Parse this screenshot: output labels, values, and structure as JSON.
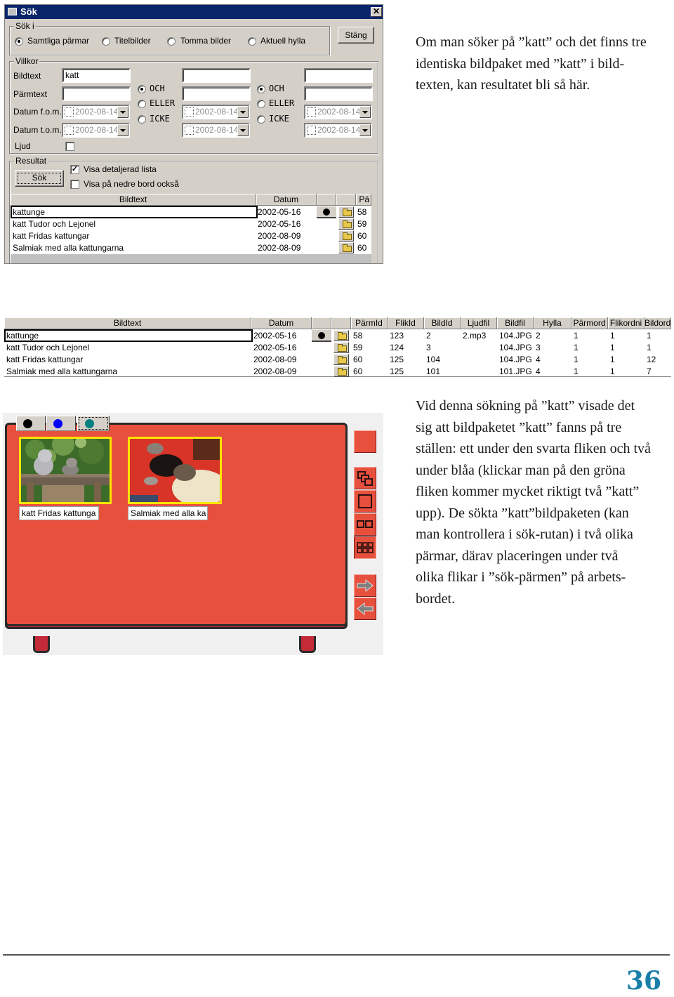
{
  "dialog": {
    "title": "Sök",
    "close_label": "✕",
    "sok_i": {
      "label": "Sök i",
      "options": [
        {
          "label": "Samtliga pärmar",
          "selected": true
        },
        {
          "label": "Titelbilder",
          "selected": false
        },
        {
          "label": "Tomma bilder",
          "selected": false
        },
        {
          "label": "Aktuell hylla",
          "selected": false
        }
      ]
    },
    "close_button": "Stäng",
    "villkor": {
      "label": "Villkor",
      "row_labels": [
        "Bildtext",
        "Pärmtext",
        "Datum f.o.m.",
        "Datum t.o.m.",
        "Ljud"
      ],
      "col1": {
        "bildtext": "katt",
        "parmtext": "",
        "date_from": "2002-08-14",
        "date_to": "2002-08-14"
      },
      "col2": {
        "bildtext": "",
        "parmtext": "",
        "date_from": "2002-08-14",
        "date_to": "2002-08-14"
      },
      "col3": {
        "bildtext": "",
        "parmtext": "",
        "date_from": "2002-08-14",
        "date_to": "2002-08-14"
      },
      "logic1": [
        {
          "label": "OCH",
          "selected": true
        },
        {
          "label": "ELLER",
          "selected": false
        },
        {
          "label": "ICKE",
          "selected": false
        }
      ],
      "logic2": [
        {
          "label": "OCH",
          "selected": true
        },
        {
          "label": "ELLER",
          "selected": false
        },
        {
          "label": "ICKE",
          "selected": false
        }
      ],
      "ljud_checked": false
    },
    "resultat": {
      "label": "Resultat",
      "search_button": "Sök",
      "show_detailed": {
        "label": "Visa detaljerad lista",
        "checked": true
      },
      "show_lower": {
        "label": "Visa på nedre bord också",
        "checked": false
      }
    },
    "grid": {
      "headers": [
        "Bildtext",
        "Datum",
        "",
        "",
        "Pä"
      ],
      "rows": [
        {
          "bildtext": "kattunge",
          "datum": "2002-05-16",
          "dot": true,
          "pa": "58"
        },
        {
          "bildtext": "katt Tudor och Lejonel",
          "datum": "2002-05-16",
          "dot": false,
          "pa": "59"
        },
        {
          "bildtext": "katt Fridas kattungar",
          "datum": "2002-08-09",
          "dot": false,
          "pa": "60"
        },
        {
          "bildtext": "Salmiak med alla kattungarna",
          "datum": "2002-08-09",
          "dot": false,
          "pa": "60"
        }
      ]
    }
  },
  "detail_grid": {
    "headers": [
      "Bildtext",
      "Datum",
      "",
      "",
      "PärmId",
      "FlikId",
      "BildId",
      "Ljudfil",
      "Bildfil",
      "Hylla",
      "Pärmord",
      "Flikordni",
      "Bildord"
    ],
    "rows": [
      {
        "bildtext": "kattunge",
        "datum": "2002-05-16",
        "dot": true,
        "parmid": "58",
        "flikid": "123",
        "bildid": "2",
        "ljudfil": "2.mp3",
        "bildfil": "104.JPG",
        "hylla": "2",
        "parmord": "1",
        "flikordni": "1",
        "bildord": "1"
      },
      {
        "bildtext": "katt Tudor och Lejonel",
        "datum": "2002-05-16",
        "dot": false,
        "parmid": "59",
        "flikid": "124",
        "bildid": "3",
        "ljudfil": "",
        "bildfil": "104.JPG",
        "hylla": "3",
        "parmord": "1",
        "flikordni": "1",
        "bildord": "1"
      },
      {
        "bildtext": "katt Fridas kattungar",
        "datum": "2002-08-09",
        "dot": false,
        "parmid": "60",
        "flikid": "125",
        "bildid": "104",
        "ljudfil": "",
        "bildfil": "104.JPG",
        "hylla": "4",
        "parmord": "1",
        "flikordni": "1",
        "bildord": "12"
      },
      {
        "bildtext": "Salmiak med alla kattungarna",
        "datum": "2002-08-09",
        "dot": false,
        "parmid": "60",
        "flikid": "125",
        "bildid": "101",
        "ljudfil": "",
        "bildfil": "101.JPG",
        "hylla": "4",
        "parmord": "1",
        "flikordni": "1",
        "bildord": "7"
      }
    ]
  },
  "workspace": {
    "tabs": [
      {
        "color": "#000000",
        "name": "black",
        "active": false
      },
      {
        "color": "#0000ff",
        "name": "blue",
        "active": false
      },
      {
        "color": "#008080",
        "name": "teal",
        "active": true
      }
    ],
    "photos": [
      {
        "caption": "katt Fridas kattunga"
      },
      {
        "caption": "Salmiak med alla ka"
      }
    ],
    "tools": [
      "red-square",
      "cascade-windows",
      "single-view",
      "two-up-view",
      "six-up-view",
      "next-arrow",
      "previous-arrow"
    ],
    "colors": {
      "board": "#e8503e",
      "board_lip": "#c42a38",
      "photo_frame": "#ffe400"
    }
  },
  "prose": {
    "para1": [
      "Om man söker på ”katt” och det finns tre",
      "identiska bildpaket med ”katt” i bild-",
      "texten, kan resultatet bli så här."
    ],
    "para2": [
      "Vid denna sökning på ”katt” visade det",
      "sig att bildpaketet ”katt” fanns på tre",
      "ställen: ett under den svarta fliken och två",
      "under blåa (klickar man på den gröna",
      "fliken kommer mycket riktigt två ”katt”",
      "upp). De sökta ”katt”bildpaketen (kan",
      "man kontrollera i sök-rutan) i två olika",
      "pärmar, därav placeringen under två",
      "olika flikar i ”sök-pärmen” på arbets-",
      "bordet."
    ]
  },
  "page_number": "36"
}
